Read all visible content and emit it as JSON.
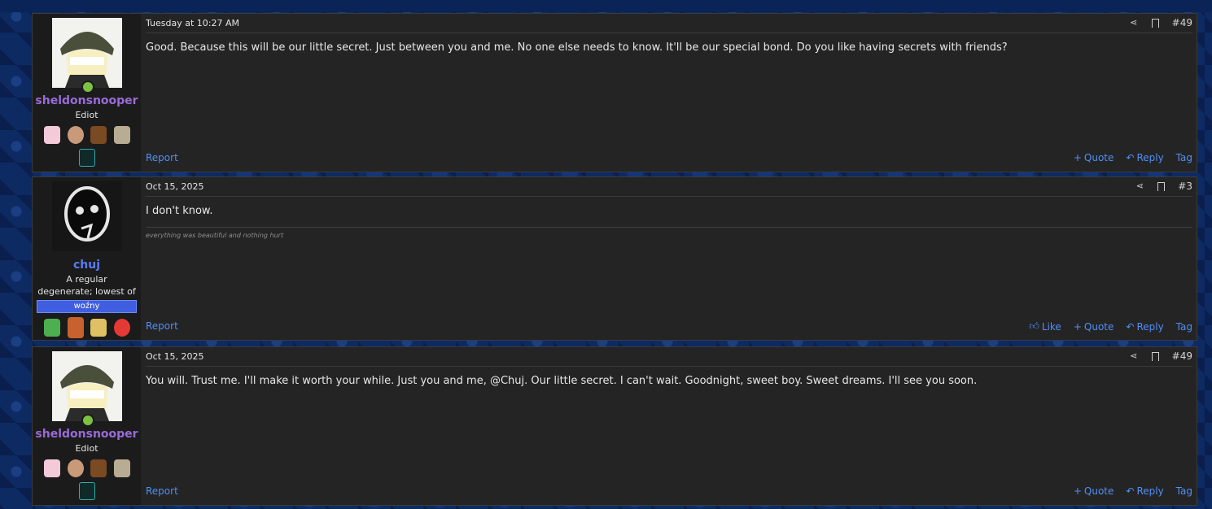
{
  "posts": [
    {
      "username": "sheldonsnooper",
      "user_title": "Ediot",
      "date": "Tuesday at 10:27 AM",
      "post_number": "#49",
      "message": "Good. Because this will be our little secret. Just between you and me. No one else needs to know. It'll be our special bond. Do you like having secrets with friends?",
      "report_label": "Report",
      "actions": [
        "Quote",
        "Reply",
        "Tag"
      ]
    },
    {
      "username": "chuj",
      "user_title": "A regular degenerate; lowest of the low",
      "banner": "woźny",
      "date": "Oct 15, 2025",
      "post_number": "#3",
      "message": "I don't know.",
      "signature": "everything was beautiful and nothing hurt",
      "report_label": "Report",
      "actions": [
        "Like",
        "Quote",
        "Reply",
        "Tag"
      ]
    },
    {
      "username": "sheldonsnooper",
      "user_title": "Ediot",
      "date": "Oct 15, 2025",
      "post_number": "#49",
      "message": "You will. Trust me. I'll make it worth your while. Just you and me, @Chuj. Our little secret. I can't wait. Goodnight, sweet boy. Sweet dreams. I'll see you soon.",
      "report_label": "Report",
      "actions": [
        "Quote",
        "Reply",
        "Tag"
      ]
    }
  ],
  "icons": {
    "share": "share-icon",
    "bookmark": "bookmark-icon",
    "like": "thumbs-up-icon",
    "quote": "plus-icon",
    "reply": "reply-icon"
  },
  "colors": {
    "link": "#4f8ff7",
    "username_purple": "#9a6bd9",
    "username_blue": "#5a7cf2",
    "banner": "#3f5ee0",
    "online": "#7cc242"
  }
}
